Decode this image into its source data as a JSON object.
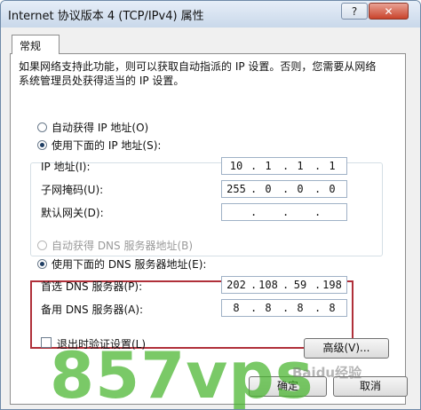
{
  "window": {
    "title": "Internet 协议版本 4 (TCP/IPv4) 属性",
    "help_label": "?",
    "close_label": "✕"
  },
  "tabs": [
    {
      "label": "常规"
    }
  ],
  "description": "如果网络支持此功能，则可以获取自动指派的 IP 设置。否则，您需要从网络系统管理员处获得适当的 IP 设置。",
  "ip_section": {
    "auto_label": "自动获得 IP 地址(O)",
    "manual_label": "使用下面的 IP 地址(S):",
    "selected": "manual",
    "fields": [
      {
        "label": "IP 地址(I):",
        "octets": [
          "10",
          "1",
          "1",
          "1"
        ]
      },
      {
        "label": "子网掩码(U):",
        "octets": [
          "255",
          "0",
          "0",
          "0"
        ]
      },
      {
        "label": "默认网关(D):",
        "octets": [
          "",
          "",
          "",
          ""
        ]
      }
    ]
  },
  "dns_section": {
    "auto_label": "自动获得 DNS 服务器地址(B)",
    "manual_label": "使用下面的 DNS 服务器地址(E):",
    "selected": "manual",
    "fields": [
      {
        "label": "首选 DNS 服务器(P):",
        "octets": [
          "202",
          "108",
          "59",
          "198"
        ]
      },
      {
        "label": "备用 DNS 服务器(A):",
        "octets": [
          "8",
          "8",
          "8",
          "8"
        ]
      }
    ]
  },
  "validate_label": "退出时验证设置(L)",
  "validate_checked": false,
  "advanced_label": "高级(V)...",
  "ok_label": "确定",
  "cancel_label": "取消",
  "watermark": "857vps",
  "watermark_small": "Baidu经验"
}
